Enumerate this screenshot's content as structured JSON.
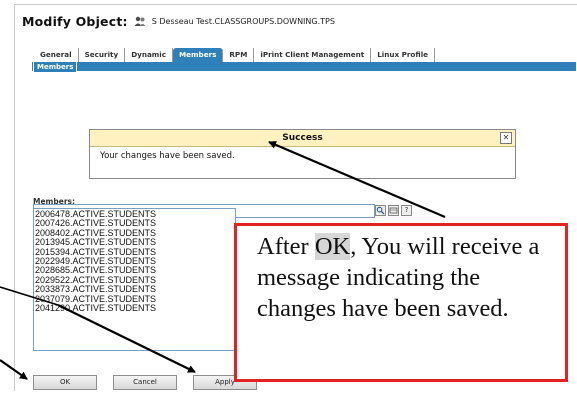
{
  "header": {
    "title": "Modify Object:",
    "object_name": "S Desseau Test.CLASSGROUPS.DOWNING.TPS"
  },
  "tabs": [
    {
      "label": "General",
      "active": false
    },
    {
      "label": "Security",
      "active": false
    },
    {
      "label": "Dynamic",
      "active": false
    },
    {
      "label": "Members",
      "active": true
    },
    {
      "label": "RPM",
      "active": false
    },
    {
      "label": "iPrint Client Management",
      "active": false
    },
    {
      "label": "Linux Profile",
      "active": false
    }
  ],
  "subtab": {
    "label": "Members"
  },
  "success": {
    "title": "Success",
    "message": "Your changes have been saved.",
    "close_glyph": "✕"
  },
  "members": {
    "label": "Members:",
    "input_value": "",
    "items": [
      "2006478.ACTIVE.STUDENTS",
      "2007426.ACTIVE.STUDENTS",
      "2008402.ACTIVE.STUDENTS",
      "2013945.ACTIVE.STUDENTS",
      "2015394.ACTIVE.STUDENTS",
      "2022949.ACTIVE.STUDENTS",
      "2028685.ACTIVE.STUDENTS",
      "2029522.ACTIVE.STUDENTS",
      "2033873.ACTIVE.STUDENTS",
      "2037079.ACTIVE.STUDENTS",
      "2041290.ACTIVE.STUDENTS"
    ]
  },
  "buttons": {
    "ok": "OK",
    "cancel": "Cancel",
    "apply": "Apply"
  },
  "callout": {
    "prefix": "After ",
    "highlight": "OK",
    "rest": ", You will receive a message indicating the changes have been saved."
  },
  "colors": {
    "tab_blue": "#2f7fb8",
    "success_header": "#fff2c0",
    "callout_border": "#e32322"
  }
}
